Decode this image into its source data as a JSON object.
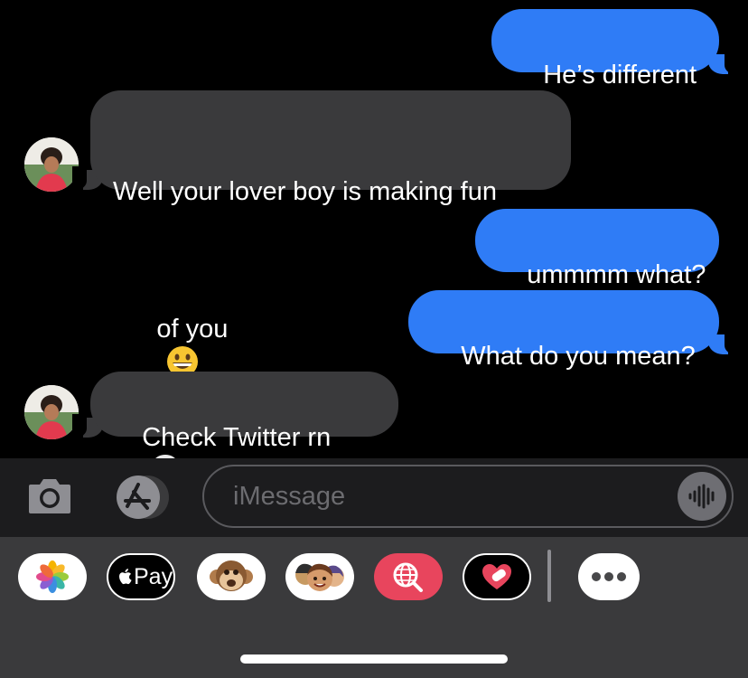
{
  "messages": [
    {
      "dir": "out",
      "text": "He’s different"
    },
    {
      "dir": "in",
      "text_line1": "Well your lover boy is making fun",
      "text_line2": "of you",
      "emoji": "grinning-face"
    },
    {
      "dir": "out",
      "text": "ummmm what?"
    },
    {
      "dir": "out",
      "text": "What do you mean?"
    },
    {
      "dir": "in",
      "text": "Check Twitter rn",
      "emoji": "skull"
    }
  ],
  "compose": {
    "placeholder": "iMessage"
  },
  "apps": [
    {
      "name": "photos"
    },
    {
      "name": "apple-pay",
      "label": "Pay"
    },
    {
      "name": "animoji"
    },
    {
      "name": "memoji-stickers"
    },
    {
      "name": "images-search"
    },
    {
      "name": "digital-touch"
    },
    {
      "name": "more"
    }
  ],
  "colors": {
    "outgoing_bubble": "#2f7cf6",
    "incoming_bubble": "#3a3a3c",
    "background": "#000000"
  }
}
